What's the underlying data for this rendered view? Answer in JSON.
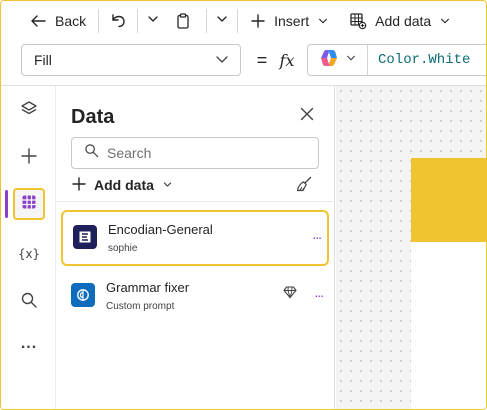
{
  "toolbar": {
    "back_label": "Back",
    "insert_label": "Insert",
    "add_data_label": "Add data"
  },
  "formula_bar": {
    "property": "Fill",
    "equals": "=",
    "fx": "fx",
    "formula": "Color.White"
  },
  "rail": {
    "items": [
      "tree-view",
      "insert",
      "data",
      "variables",
      "search",
      "more"
    ],
    "variables_label": "{x}",
    "more_label": "...",
    "active": "data"
  },
  "data_pane": {
    "title": "Data",
    "search_placeholder": "Search",
    "add_data_label": "Add data",
    "connections": [
      {
        "name": "Encodian-General",
        "subtitle": "sophie",
        "more": "...",
        "selected": true
      },
      {
        "name": "Grammar fixer",
        "subtitle": "Custom prompt",
        "more": "...",
        "premium": true,
        "selected": false
      }
    ]
  },
  "colors": {
    "accent_purple": "#8a3ec9",
    "highlight_yellow": "#f0c431",
    "formula_text": "#0f6c74",
    "encodian_icon": "#1f1f5c",
    "grammar_icon": "#0f6cbd"
  }
}
